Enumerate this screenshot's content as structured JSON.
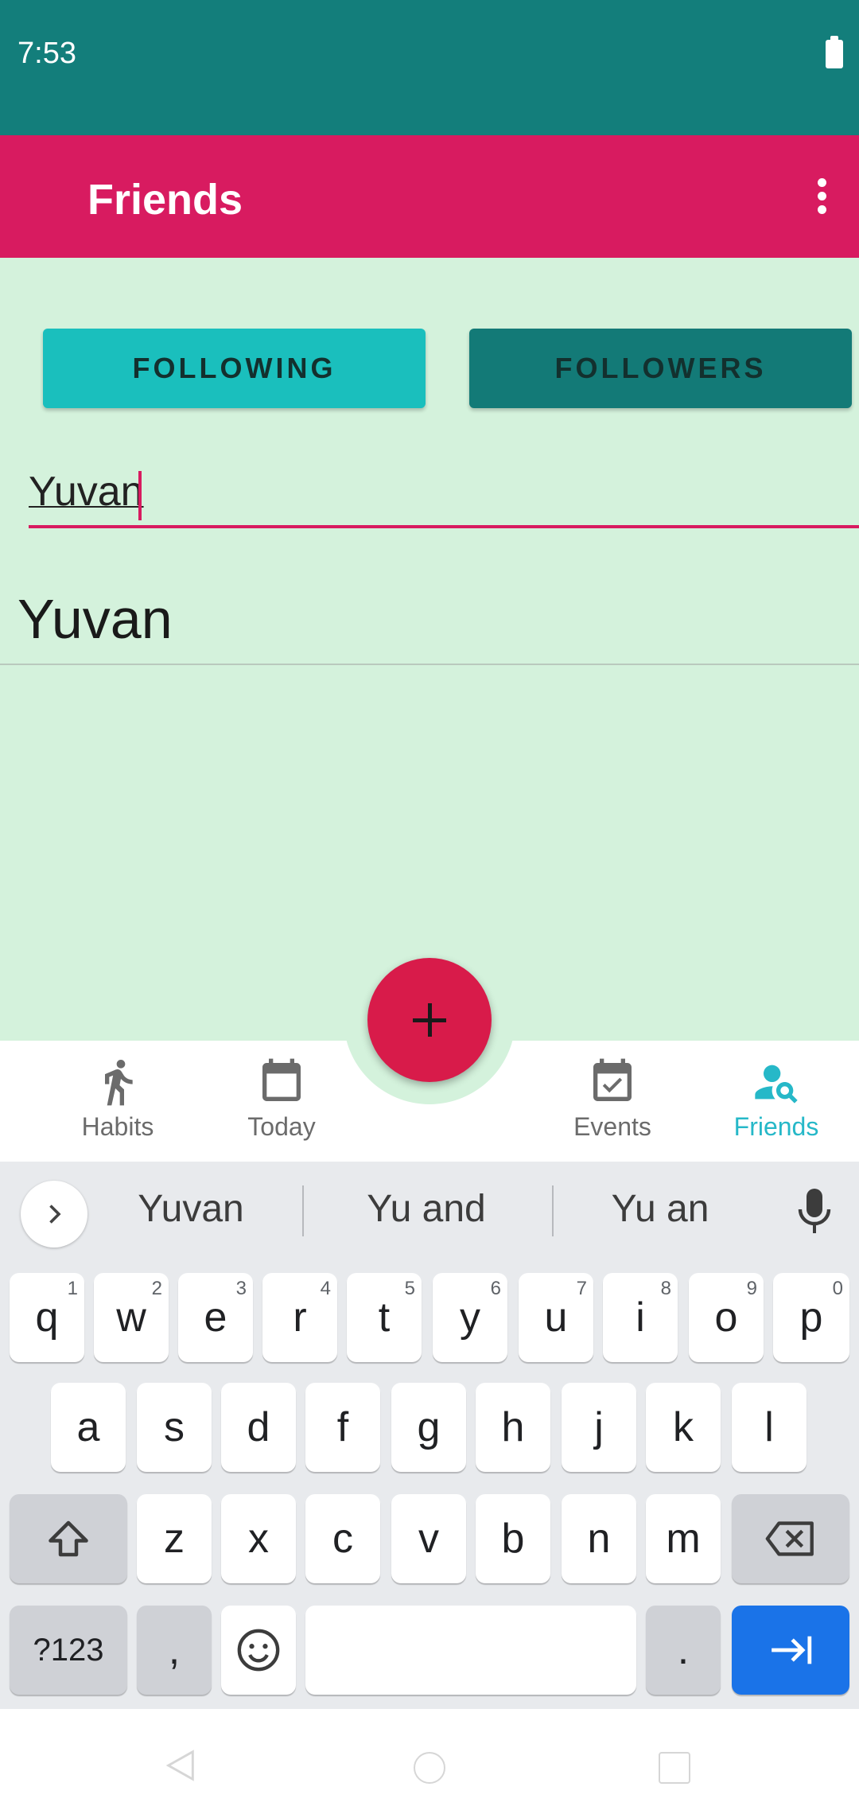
{
  "status_bar": {
    "time": "7:53"
  },
  "app_bar": {
    "title": "Friends"
  },
  "tabs": {
    "following": "FOLLOWING",
    "followers": "FOLLOWERS"
  },
  "search": {
    "value": "Yuvan"
  },
  "results": [
    {
      "name": "Yuvan"
    }
  ],
  "bottom_nav": {
    "items": [
      {
        "label": "Habits",
        "icon": "running-person-icon"
      },
      {
        "label": "Today",
        "icon": "calendar-icon"
      },
      {
        "label": "Events",
        "icon": "event-check-icon"
      },
      {
        "label": "Friends",
        "icon": "person-search-icon",
        "active": true
      }
    ]
  },
  "fab": {
    "icon": "plus-icon",
    "color": "#d81b4a"
  },
  "keyboard": {
    "suggestions": [
      "Yuvan",
      "Yu and",
      "Yu an"
    ],
    "row1": [
      {
        "key": "q",
        "hint": "1"
      },
      {
        "key": "w",
        "hint": "2"
      },
      {
        "key": "e",
        "hint": "3"
      },
      {
        "key": "r",
        "hint": "4"
      },
      {
        "key": "t",
        "hint": "5"
      },
      {
        "key": "y",
        "hint": "6"
      },
      {
        "key": "u",
        "hint": "7"
      },
      {
        "key": "i",
        "hint": "8"
      },
      {
        "key": "o",
        "hint": "9"
      },
      {
        "key": "p",
        "hint": "0"
      }
    ],
    "row2": [
      "a",
      "s",
      "d",
      "f",
      "g",
      "h",
      "j",
      "k",
      "l"
    ],
    "row3": [
      "z",
      "x",
      "c",
      "v",
      "b",
      "n",
      "m"
    ],
    "symbols_label": "?123",
    "comma": ",",
    "period": "."
  },
  "colors": {
    "status_bar": "#137e7b",
    "app_bar": "#d81b60",
    "background": "#d4f2dc",
    "following_button": "#1abfbd",
    "followers_button": "#137a77",
    "active_nav": "#26b8c8",
    "enter_key": "#1a73e8"
  }
}
